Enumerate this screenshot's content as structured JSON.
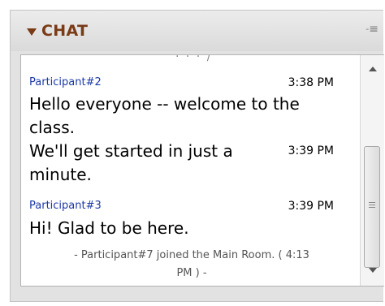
{
  "panel": {
    "title": "CHAT",
    "menu_icon": "panel-menu-icon",
    "collapse_icon": "collapse-triangle-icon"
  },
  "chat": {
    "partial_top": "· · · /",
    "messages": [
      {
        "sender": "Participant#2",
        "time": "3:38 PM",
        "text_lines": [
          "Hello everyone -- welcome to the",
          "class."
        ]
      },
      {
        "sender": "",
        "time": "3:39 PM",
        "text_lines": [
          "We'll get started in just a",
          "minute."
        ]
      },
      {
        "sender": "Participant#3",
        "time": "3:39 PM",
        "text_lines": [
          "Hi! Glad to be here."
        ]
      }
    ],
    "system_message": {
      "line1": "- Participant#7 joined the Main Room. ( 4:13",
      "line2": "PM ) -"
    }
  },
  "colors": {
    "title": "#7a3b16",
    "sender": "#1c39a8",
    "panel_bg": "#e2e2e2",
    "chat_bg": "#ffffff"
  }
}
